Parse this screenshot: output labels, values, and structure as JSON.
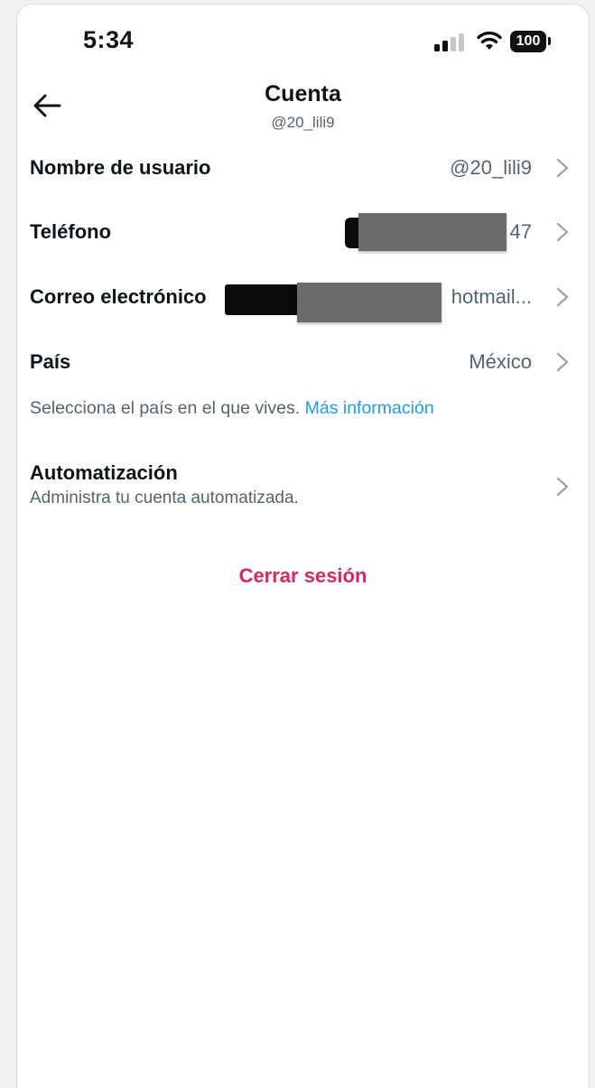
{
  "status_bar": {
    "time": "5:34",
    "battery": "100"
  },
  "header": {
    "title": "Cuenta",
    "subtitle": "@20_lili9"
  },
  "rows": [
    {
      "label": "Nombre de usuario",
      "value": "@20_lili9"
    },
    {
      "label": "Teléfono",
      "value": "47"
    },
    {
      "label": "Correo electrónico",
      "value": "hotmail..."
    },
    {
      "label": "País",
      "value": "México"
    }
  ],
  "country_hint": {
    "text": "Selecciona el país en el que vives.",
    "link": "Más información"
  },
  "automation": {
    "title": "Automatización",
    "subtitle": "Administra tu cuenta automatizada."
  },
  "logout_label": "Cerrar sesión",
  "colors": {
    "link": "#1d9bf0",
    "danger": "#e0245e",
    "secondary_text": "#536471",
    "chevron": "#9aa4ab"
  },
  "icons": [
    "back-arrow-icon",
    "cellular-signal-icon",
    "wifi-icon",
    "battery-icon",
    "chevron-right-icon"
  ]
}
